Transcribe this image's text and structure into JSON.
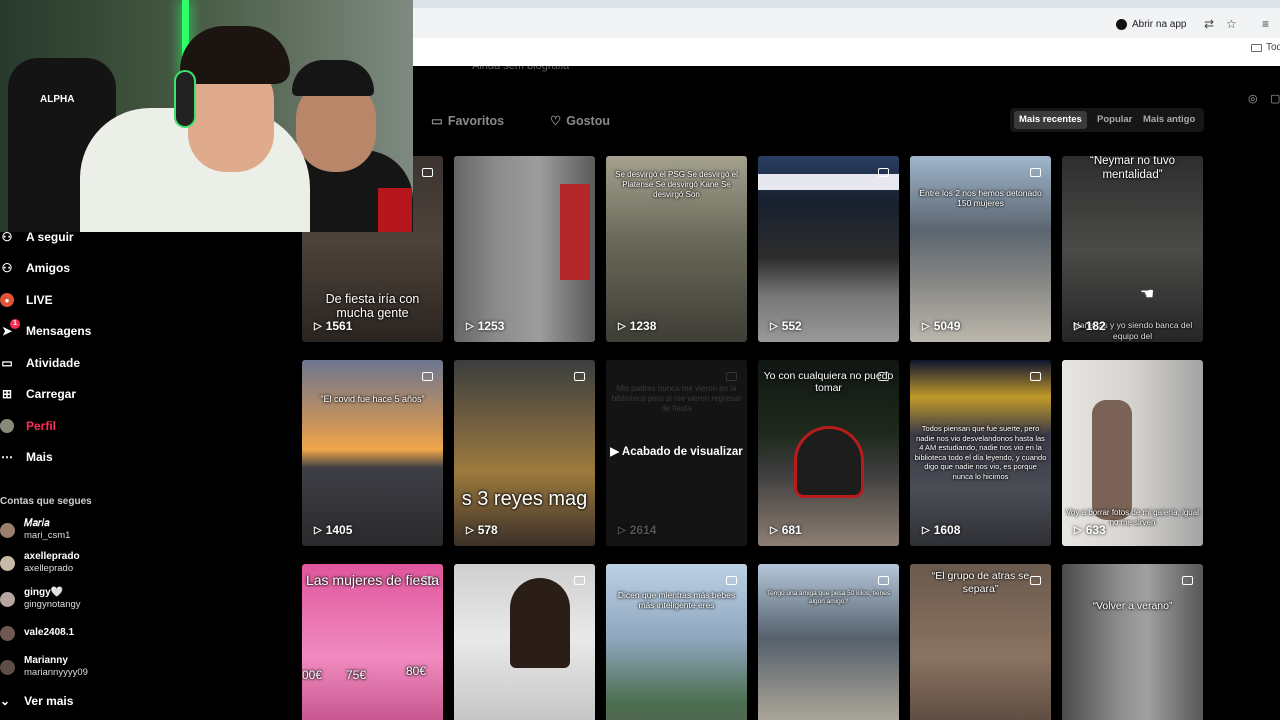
{
  "browser": {
    "open_app_label": "Abrir na app",
    "bookmark_label": "Todo"
  },
  "profile": {
    "hint_text": "Ainda sem biografia"
  },
  "sidebar": {
    "items": [
      {
        "label": "A seguir",
        "icon": "people-icon"
      },
      {
        "label": "Amigos",
        "icon": "friends-icon"
      },
      {
        "label": "LIVE",
        "icon": "live-icon"
      },
      {
        "label": "Mensagens",
        "icon": "messages-icon",
        "badge": "1"
      },
      {
        "label": "Atividade",
        "icon": "activity-icon"
      },
      {
        "label": "Carregar",
        "icon": "upload-icon"
      },
      {
        "label": "Perfil",
        "icon": "profile-icon",
        "active": true
      },
      {
        "label": "Mais",
        "icon": "more-icon"
      }
    ],
    "following_header": "Contas que segues",
    "accounts": [
      {
        "name": "𝑀𝑎𝑟𝑖𝑎",
        "handle": "mari_csm1"
      },
      {
        "name": "axelleprado",
        "handle": "axelleprado"
      },
      {
        "name": "gingy🤍",
        "handle": "gingynotangy"
      },
      {
        "name": "",
        "handle": "vale2408.1"
      },
      {
        "name": "Marianny",
        "handle": "mariannyyyy09"
      }
    ],
    "see_more": "Ver mais"
  },
  "tabs": [
    {
      "label": "Favoritos",
      "icon": "bookmark-icon"
    },
    {
      "label": "Gostou",
      "icon": "heart-icon"
    }
  ],
  "sort": [
    "Mais recentes",
    "Popular",
    "Mais antigo"
  ],
  "sort_selected": "Mais recentes",
  "videos": [
    {
      "caption": "De fiesta iría con mucha gente",
      "views": "1561"
    },
    {
      "caption": "",
      "views": "1253"
    },
    {
      "caption": "Se desvirgó el PSG Se desvirgó el Platense Se desvirgó Kane Se desvirgó Son",
      "views": "1238"
    },
    {
      "caption": "",
      "views": "552"
    },
    {
      "caption": "Entre los 2 nos hemos detonado 150 mujeres",
      "views": "5049"
    },
    {
      "caption": "“Neymar no tuvo mentalidad”",
      "views": "182",
      "bottom": "Mañanas y yo siendo banca del equipo del"
    },
    {
      "caption": "“El covid fue hace 5 años”",
      "views": "1405"
    },
    {
      "caption": "s 3 reyes mag",
      "views": "578"
    },
    {
      "caption": "Mis padres nunca me vieron en la biblioteca pero si me vieron regresar de fiesta",
      "views": "2614",
      "watched": "Acabado de visualizar"
    },
    {
      "caption": "Yo con cualquiera no puedo tomar",
      "views": "681"
    },
    {
      "caption": "Todos piensan que fue suerte, pero nadie nos vio desvelandonos hasta las 4 AM estudiando, nadie nos vio en la biblioteca todo el día leyendo, y cuando digo que nadie nos vio, es porque nunca lo hicimos",
      "views": "1608"
    },
    {
      "caption": "Voy a borrar fotos de mi galería, igual no me sirven",
      "views": "633"
    },
    {
      "caption": "Las mujeres de fiesta",
      "views": "",
      "prices": [
        "00€",
        "75€",
        "80€"
      ]
    },
    {
      "caption": "",
      "views": ""
    },
    {
      "caption": "Dicen que mientras más bebes más inteligente eres",
      "views": ""
    },
    {
      "caption": "Tengo una amiga que pesa 50 kilos, tienes algún amigo?",
      "views": ""
    },
    {
      "caption": "“El grupo de atras se separa”",
      "views": ""
    },
    {
      "caption": "“Volver a verano”",
      "views": ""
    }
  ],
  "colors": {
    "accent": "#fe2c55",
    "background": "#000000"
  }
}
